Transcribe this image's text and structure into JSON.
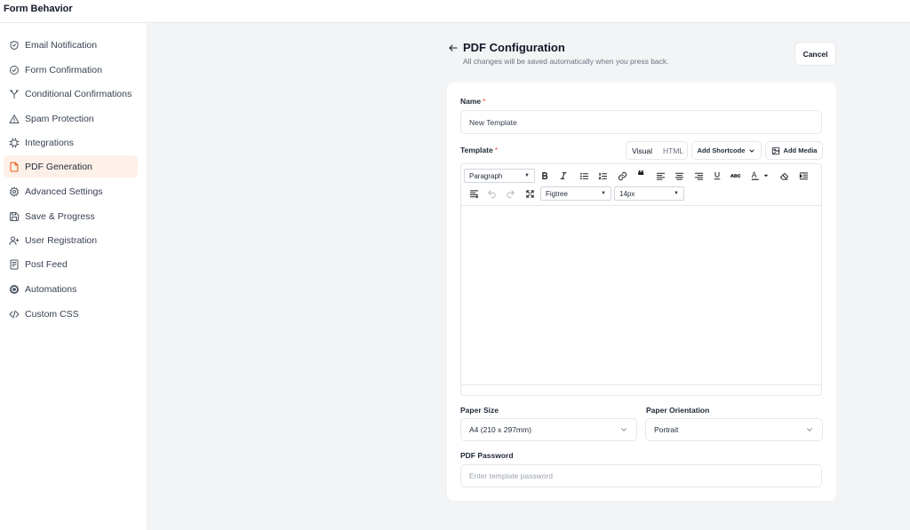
{
  "topbar": {
    "title": "Form Behavior"
  },
  "sidebar": {
    "items": [
      {
        "label": "Email Notification",
        "icon": "shield-check-icon",
        "active": false
      },
      {
        "label": "Form Confirmation",
        "icon": "circle-check-icon",
        "active": false
      },
      {
        "label": "Conditional Confirmations",
        "icon": "split-icon",
        "active": false
      },
      {
        "label": "Spam Protection",
        "icon": "warning-triangle-icon",
        "active": false
      },
      {
        "label": "Integrations",
        "icon": "chip-icon",
        "active": false
      },
      {
        "label": "PDF Generation",
        "icon": "file-icon",
        "active": true
      },
      {
        "label": "Advanced Settings",
        "icon": "gear-icon",
        "active": false
      },
      {
        "label": "Save & Progress",
        "icon": "save-icon",
        "active": false
      },
      {
        "label": "User Registration",
        "icon": "user-plus-icon",
        "active": false
      },
      {
        "label": "Post Feed",
        "icon": "document-icon",
        "active": false
      },
      {
        "label": "Automations",
        "icon": "automation-icon",
        "active": false
      },
      {
        "label": "Custom CSS",
        "icon": "code-icon",
        "active": false
      }
    ]
  },
  "header": {
    "title": "PDF Configuration",
    "subtitle": "All changes will be saved automatically when you press back.",
    "cancel_label": "Cancel"
  },
  "form": {
    "name_label": "Name",
    "name_value": "New Template",
    "template_label": "Template",
    "required_mark": "*",
    "mode_visual": "Visual",
    "mode_html": "HTML",
    "add_shortcode_label": "Add Shortcode",
    "add_media_label": "Add Media",
    "editor": {
      "block_format": "Paragraph",
      "font_family": "Figtree",
      "font_size": "14px"
    },
    "paper_size_label": "Paper Size",
    "paper_size_value": "A4 (210 x 297mm)",
    "orientation_label": "Paper Orientation",
    "orientation_value": "Portrait",
    "password_label": "PDF Password",
    "password_placeholder": "Enter template password"
  },
  "colors": {
    "accent": "#ea580c",
    "active_bg": "#fdf0e8",
    "required": "#ef4444",
    "page_bg": "#f3f4f6"
  }
}
